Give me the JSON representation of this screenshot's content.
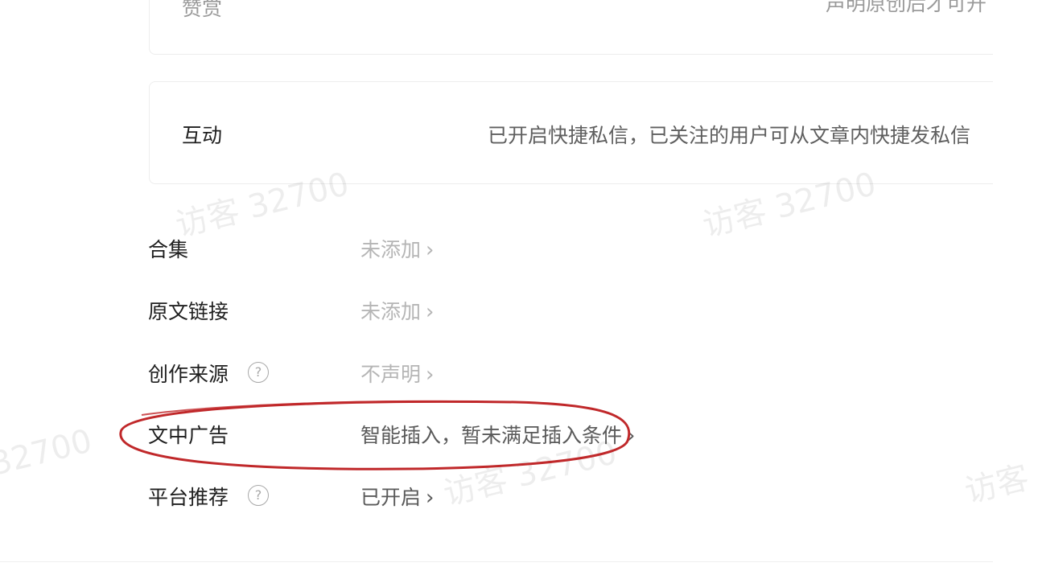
{
  "cards": {
    "top": {
      "label": "赞赏",
      "value": "声明原创后才可开"
    },
    "interaction": {
      "label": "互动",
      "value": "已开启快捷私信，已关注的用户可从文章内快捷发私信"
    }
  },
  "settings": [
    {
      "label": "合集",
      "value": "未添加",
      "help": false
    },
    {
      "label": "原文链接",
      "value": "未添加",
      "help": false
    },
    {
      "label": "创作来源",
      "value": "不声明",
      "help": true
    },
    {
      "label": "文中广告",
      "value": "智能插入，暂未满足插入条件",
      "help": false
    },
    {
      "label": "平台推荐",
      "value": "已开启",
      "help": true
    }
  ],
  "icons": {
    "help": "help-circle-icon",
    "chevron": "chevron-right-icon"
  },
  "help_glyph": "?",
  "chevron_glyph": "›",
  "watermarks": [
    "访客 32700",
    "访客 32700",
    "32700",
    "访客 32700",
    "访客"
  ],
  "colors": {
    "annotation": "#c0282a",
    "muted": "#b5b5b5",
    "text": "#1f1f1f"
  }
}
